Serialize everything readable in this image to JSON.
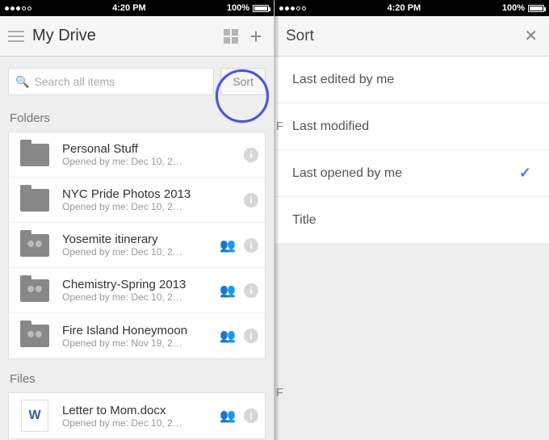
{
  "status": {
    "time": "4:20 PM",
    "battery": "100%"
  },
  "left": {
    "title": "My Drive",
    "search_placeholder": "Search all items",
    "sort_btn": "Sort",
    "sections": {
      "folders": "Folders",
      "files": "Files"
    },
    "folders": [
      {
        "name": "Personal Stuff",
        "sub": "Opened by me: Dec 10, 2…",
        "shared": false
      },
      {
        "name": "NYC Pride Photos 2013",
        "sub": "Opened by me: Dec 10, 2…",
        "shared": false
      },
      {
        "name": "Yosemite itinerary",
        "sub": "Opened by me: Dec 10, 2…",
        "shared": true
      },
      {
        "name": "Chemistry-Spring 2013",
        "sub": "Opened by me: Dec 10, 2…",
        "shared": true
      },
      {
        "name": "Fire Island Honeymoon",
        "sub": "Opened by me: Nov 19, 2…",
        "shared": true
      }
    ],
    "files": [
      {
        "name": "Letter to Mom.docx",
        "sub": "Opened by me: Dec 10, 2…",
        "shared": true,
        "kind": "docx",
        "glyph": "W"
      }
    ]
  },
  "right": {
    "title": "Sort",
    "options": [
      {
        "label": "Last edited by me",
        "selected": false
      },
      {
        "label": "Last modified",
        "selected": false
      },
      {
        "label": "Last opened by me",
        "selected": true
      },
      {
        "label": "Title",
        "selected": false
      }
    ],
    "peek_labels": {
      "folders_initial": "F",
      "files_initial": "F"
    }
  }
}
